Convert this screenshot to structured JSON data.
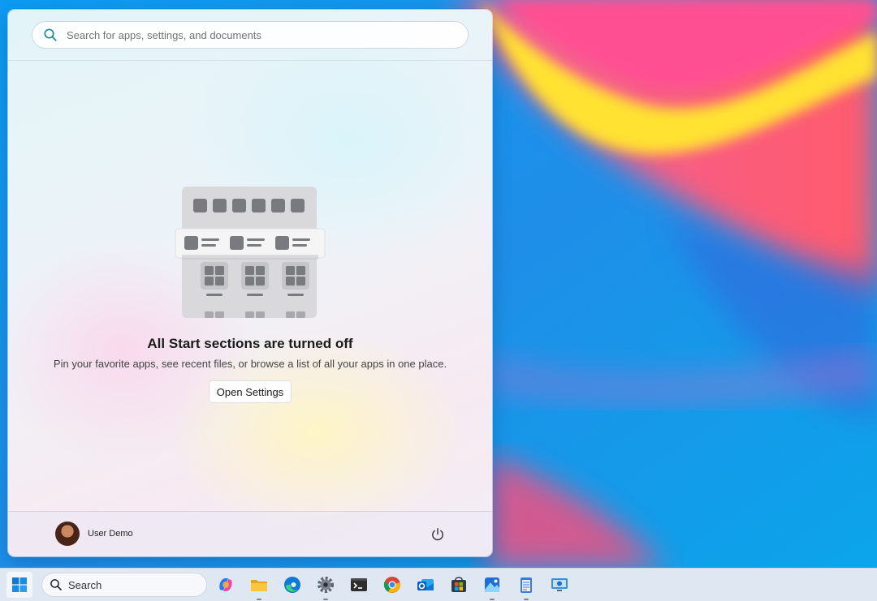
{
  "search": {
    "placeholder": "Search for apps, settings, and documents"
  },
  "empty_state": {
    "title": "All Start sections are turned off",
    "description": "Pin your favorite apps, see recent files, or browse a list of all your apps in one place.",
    "button_label": "Open Settings"
  },
  "footer": {
    "user_name": "User Demo"
  },
  "taskbar": {
    "search_label": "Search",
    "apps": [
      "copilot-icon",
      "file-explorer-icon",
      "edge-icon",
      "settings-icon",
      "terminal-icon",
      "chrome-icon",
      "outlook-icon",
      "store-icon",
      "photos-icon",
      "notepad-icon",
      "remote-desktop-icon"
    ]
  }
}
